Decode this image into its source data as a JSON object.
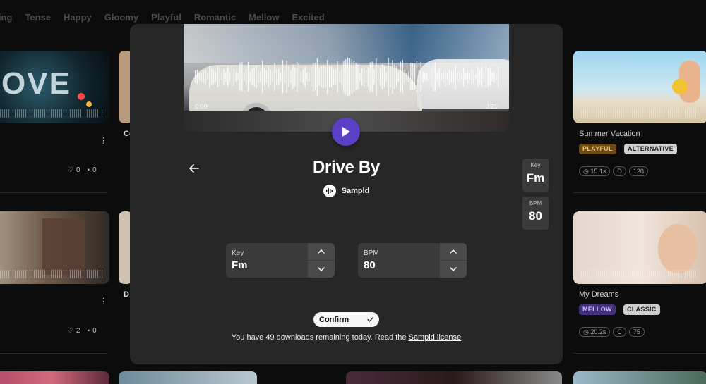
{
  "moods": [
    "ning",
    "Tense",
    "Happy",
    "Gloomy",
    "Playful",
    "Romantic",
    "Mellow",
    "Excited"
  ],
  "cards": {
    "left_top": {
      "likes": "0",
      "comments": "0"
    },
    "left_bottom": {
      "likes": "2",
      "comments": "0"
    },
    "mid_top": {
      "title_fragment": "Co"
    },
    "mid_bottom": {
      "title_fragment": "D"
    },
    "summer": {
      "title": "Summer Vacation",
      "mood": "PLAYFUL",
      "genre": "ALTERNATIVE",
      "duration": "15.1s",
      "key": "D",
      "bpm": "120"
    },
    "dreams": {
      "title": "My Dreams",
      "mood": "MELLOW",
      "genre": "CLASSIC",
      "duration": "20.2s",
      "key": "C",
      "bpm": "75"
    }
  },
  "modal": {
    "time_start": "0:00",
    "time_end": "0:25",
    "title": "Drive By",
    "artist": "Sampld",
    "key_label": "Key",
    "key_value": "Fm",
    "bpm_label": "BPM",
    "bpm_value": "80",
    "confirm_label": "Confirm",
    "note_text": "You have 49 downloads remaining today. Read the ",
    "note_link": "Sampld license"
  },
  "colors": {
    "accent": "#5b3fc4",
    "modal_bg": "#272727",
    "page_bg": "#0c0c0c"
  }
}
